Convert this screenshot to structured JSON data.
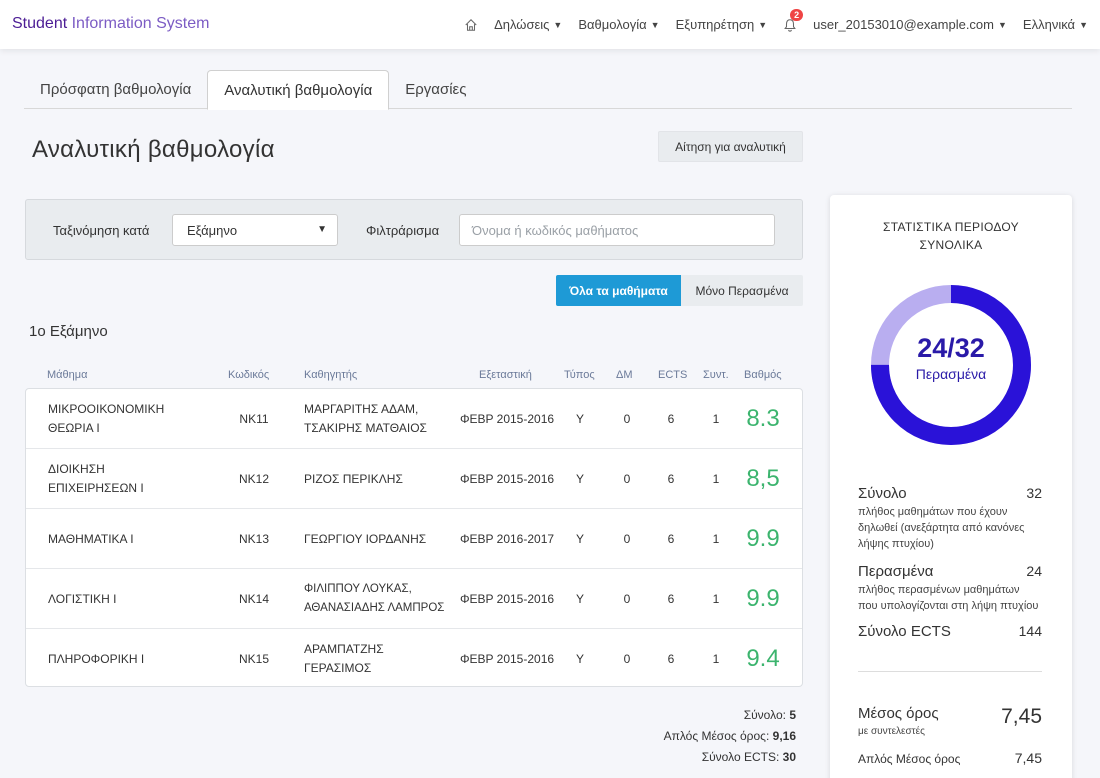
{
  "navbar": {
    "brand_part1": "Student",
    "brand_part2": "Information System",
    "menu": [
      "Δηλώσεις",
      "Βαθμολογία",
      "Εξυπηρέτηση"
    ],
    "notifications_count": "2",
    "user": "user_20153010@example.com",
    "language": "Ελληνικά"
  },
  "tabs": [
    "Πρόσφατη βαθμολογία",
    "Αναλυτική βαθμολογία",
    "Εργασίες"
  ],
  "page_title": "Αναλυτική βαθμολογία",
  "request_button": "Αίτηση για αναλυτική",
  "filters": {
    "sort_label": "Ταξινόμηση κατά",
    "sort_value": "Εξάμηνο",
    "filter_label": "Φιλτράρισμα",
    "filter_placeholder": "Όνομα ή κωδικός μαθήματος"
  },
  "toggle": {
    "all": "Όλα τα μαθήματα",
    "passed": "Μόνο Περασμένα"
  },
  "semester_title": "1ο Εξάμηνο",
  "table": {
    "headers": [
      "Μάθημα",
      "Κωδικός",
      "Καθηγητής",
      "Εξεταστική",
      "Τύπος",
      "ΔΜ",
      "ECTS",
      "Συντ.",
      "Βαθμός"
    ],
    "rows": [
      {
        "course": "ΜΙΚΡΟΟΙΚΟΝΟΜΙΚΗ ΘΕΩΡΙΑ Ι",
        "code": "NK11",
        "professor": "ΜΑΡΓΑΡΙΤΗΣ ΑΔΑΜ, ΤΣΑΚΙΡΗΣ ΜΑΤΘΑΙΟΣ",
        "exam": "ΦΕΒΡ 2015-2016",
        "type": "Υ",
        "dm": "0",
        "ects": "6",
        "coef": "1",
        "grade": "8.3"
      },
      {
        "course": "ΔΙΟΙΚΗΣΗ ΕΠΙΧΕΙΡΗΣΕΩΝ Ι",
        "code": "NK12",
        "professor": "ΡΙΖΟΣ ΠΕΡΙΚΛΗΣ",
        "exam": "ΦΕΒΡ 2015-2016",
        "type": "Υ",
        "dm": "0",
        "ects": "6",
        "coef": "1",
        "grade": "8,5"
      },
      {
        "course": "ΜΑΘΗΜΑΤΙΚΑ Ι",
        "code": "NK13",
        "professor": "ΓΕΩΡΓΙΟΥ ΙΟΡΔΑΝΗΣ",
        "exam": "ΦΕΒΡ 2016-2017",
        "type": "Υ",
        "dm": "0",
        "ects": "6",
        "coef": "1",
        "grade": "9.9"
      },
      {
        "course": "ΛΟΓΙΣΤΙΚΗ Ι",
        "code": "NK14",
        "professor": "ΦΙΛΙΠΠΟΥ ΛΟΥΚΑΣ, ΑΘΑΝΑΣΙΑΔΗΣ ΛΑΜΠΡΟΣ",
        "exam": "ΦΕΒΡ 2015-2016",
        "type": "Υ",
        "dm": "0",
        "ects": "6",
        "coef": "1",
        "grade": "9.9"
      },
      {
        "course": "ΠΛΗΡΟΦΟΡΙΚΗ Ι",
        "code": "NK15",
        "professor": "ΑΡΑΜΠΑΤΖΗΣ ΓΕΡΑΣΙΜΟΣ",
        "exam": "ΦΕΒΡ 2015-2016",
        "type": "Υ",
        "dm": "0",
        "ects": "6",
        "coef": "1",
        "grade": "9.4"
      }
    ]
  },
  "totals": {
    "total_label": "Σύνολο:",
    "total_value": "5",
    "avg_label": "Απλός Μέσος όρος:",
    "avg_value": "9,16",
    "ects_label": "Σύνολο ECTS:",
    "ects_value": "30"
  },
  "stats": {
    "title_line1": "ΣΤΑΤΙΣΤΙΚΑ ΠΕΡΙΟΔΟΥ",
    "title_line2": "ΣΥΝΟΛΙΚΑ",
    "donut_text": "24/32",
    "donut_label": "Περασμένα",
    "passed": 24,
    "total": 32,
    "ring_color": "#2a12d8",
    "ring_rest_color": "#b9aef0",
    "total_label": "Σύνολο",
    "total_value": "32",
    "total_desc": "πλήθος μαθημάτων που έχουν δηλωθεί (ανεξάρτητα από κανόνες λήψης πτυχίου)",
    "passed_label": "Περασμένα",
    "passed_value": "24",
    "passed_desc": "πλήθος περασμένων μαθημάτων που υπολογίζονται στη λήψη πτυχίου",
    "ects_label": "Σύνολο ECTS",
    "ects_value": "144",
    "avg_label": "Μέσος όρος",
    "avg_sub": "με συντελεστές",
    "avg_value": "7,45",
    "simple_avg_label": "Απλός Μέσος όρος",
    "simple_avg_value": "7,45"
  }
}
